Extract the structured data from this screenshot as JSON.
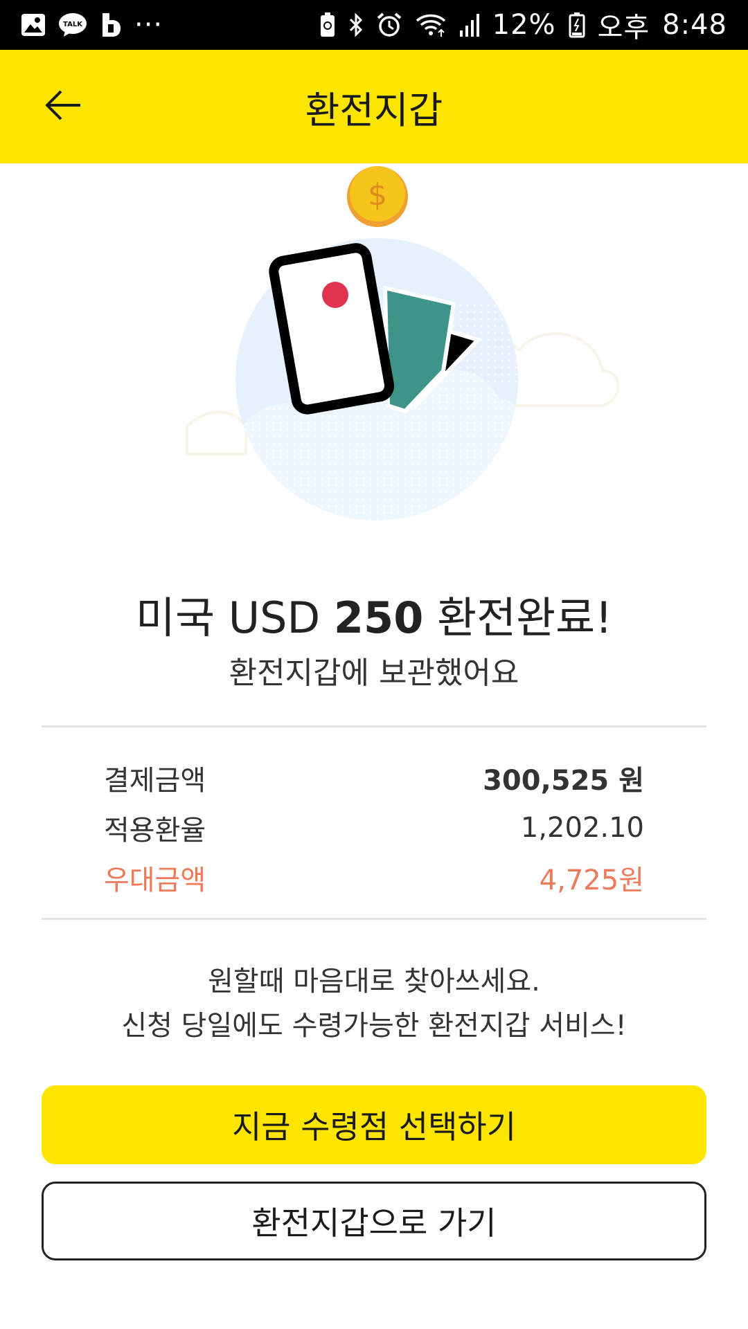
{
  "status_bar": {
    "left_icons": [
      "gallery-icon",
      "kakaotalk-icon",
      "band-icon",
      "more-dots-icon"
    ],
    "kakaotalk_badge": "TALK",
    "more_dots": "···",
    "right_icons": [
      "battery-saver-icon",
      "bluetooth-icon",
      "alarm-icon",
      "wifi-icon",
      "signal-icon"
    ],
    "battery_percent": "12%",
    "ampm": "오후",
    "time": "8:48"
  },
  "header": {
    "title": "환전지갑",
    "back_icon": "arrow-left-icon"
  },
  "hero": {
    "coin_symbol": "$",
    "colors": {
      "circle": "#e5f1ff",
      "coin": "#f5c51c",
      "coin_ring": "#f0a030",
      "teal_card": "#3e9488",
      "red_dot": "#e0334f"
    }
  },
  "result": {
    "country": "미국",
    "currency": "USD",
    "amount": "250",
    "status": "환전완료!",
    "subtitle": "환전지갑에 보관했어요"
  },
  "summary": {
    "rows": [
      {
        "label": "결제금액",
        "value": "300,525 원"
      },
      {
        "label": "적용환율",
        "value": "1,202.10"
      },
      {
        "label": "우대금액",
        "value": "4,725원"
      }
    ],
    "discount_color": "#ee7a5a"
  },
  "notice": {
    "line1": "원할때 마음대로 찾아쓰세요.",
    "line2": "신청 당일에도 수령가능한 환전지갑 서비스!"
  },
  "buttons": {
    "primary": "지금 수령점 선택하기",
    "secondary": "환전지갑으로 가기"
  },
  "colors": {
    "brand_yellow": "#fee500"
  }
}
